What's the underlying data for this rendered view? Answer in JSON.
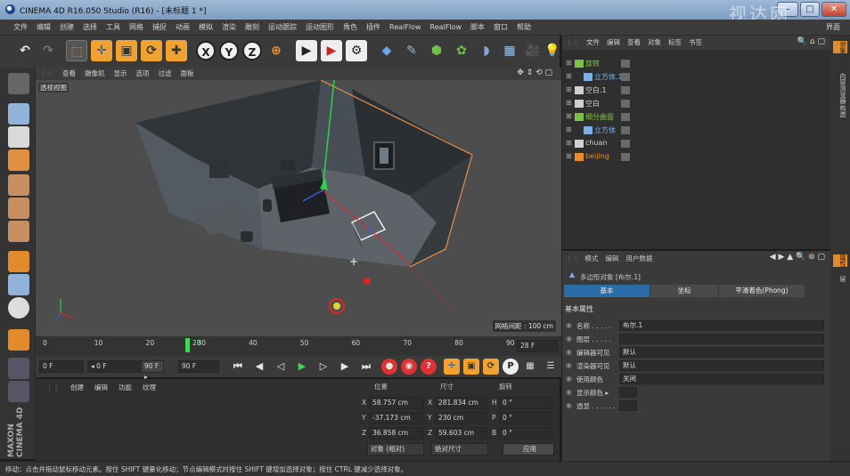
{
  "window": {
    "title": "CINEMA 4D R16.050 Studio (R16) - [未标题 1 *]",
    "watermark": "视达网"
  },
  "menu": [
    "文件",
    "编辑",
    "创建",
    "选择",
    "工具",
    "网格",
    "捕捉",
    "动画",
    "模拟",
    "渲染",
    "雕刻",
    "运动跟踪",
    "运动图形",
    "角色",
    "插件",
    "RealFlow",
    "RealFlow",
    "脚本",
    "窗口",
    "帮助"
  ],
  "menu_right": "界面",
  "toolbar": {
    "x": "X",
    "y": "Y",
    "z": "Z"
  },
  "viewport": {
    "menu": [
      "查看",
      "摄像机",
      "显示",
      "选项",
      "过滤",
      "面板"
    ],
    "label": "透视视图",
    "grid_info": "网格间距 : 100 cm"
  },
  "timeline": {
    "ticks": [
      "0",
      "10",
      "20",
      "30",
      "40",
      "50",
      "60",
      "70",
      "80",
      "90"
    ],
    "current_frame": "28",
    "end_field": "28 F",
    "field_start": "0 F",
    "field_min": "◂ 0 F",
    "field_max": "90 F ▸",
    "field_end": "90 F"
  },
  "material_panel": {
    "tabs": [
      "创建",
      "编辑",
      "功能",
      "纹理"
    ]
  },
  "coords": {
    "headers": [
      "位置",
      "尺寸",
      "旋转"
    ],
    "rows": [
      {
        "axis": "X",
        "pos": "58.757 cm",
        "size_axis": "X",
        "size": "281.834 cm",
        "rot_axis": "H",
        "rot": "0 °"
      },
      {
        "axis": "Y",
        "pos": "-37.173 cm",
        "size_axis": "Y",
        "size": "230 cm",
        "rot_axis": "P",
        "rot": "0 °"
      },
      {
        "axis": "Z",
        "pos": "36.858 cm",
        "size_axis": "Z",
        "size": "59.603 cm",
        "rot_axis": "B",
        "rot": "0 °"
      }
    ],
    "mode_object": "对象 (相对)",
    "mode_size": "绝对尺寸",
    "apply": "应用"
  },
  "objects_panel": {
    "menu": [
      "文件",
      "编辑",
      "查看",
      "对象",
      "标签",
      "书签"
    ],
    "items": [
      {
        "name": "旋转",
        "color": "#7ec242",
        "level": 0
      },
      {
        "name": "立方体.1",
        "color": "#7ab0e6",
        "level": 1
      },
      {
        "name": "空白.1",
        "color": "#d0d0d0",
        "level": 0
      },
      {
        "name": "空白",
        "color": "#d0d0d0",
        "level": 0
      },
      {
        "name": "细分曲面",
        "color": "#7ec242",
        "level": 0
      },
      {
        "name": "立方体",
        "color": "#7ab0e6",
        "level": 1
      },
      {
        "name": "chuan",
        "color": "#d0d0d0",
        "level": 0
      },
      {
        "name": "beijing",
        "color": "#e8902a",
        "level": 0
      }
    ]
  },
  "attributes_panel": {
    "menu": [
      "模式",
      "编辑",
      "用户数据"
    ],
    "object_title": "多边形对象 [布尔.1]",
    "tabs": [
      "基本",
      "坐标",
      "平滑着色(Phong)"
    ],
    "section": "基本属性",
    "fields": [
      {
        "label": "名称 . . . . .",
        "value": "布尔.1"
      },
      {
        "label": "图层 . . . . .",
        "value": ""
      },
      {
        "label": "编辑器可见",
        "value": "默认"
      },
      {
        "label": "渲染器可见",
        "value": "默认"
      },
      {
        "label": "使用颜色",
        "value": "关闭"
      },
      {
        "label": "显示颜色 ▸",
        "value": ""
      },
      {
        "label": "透显 . . . . . .",
        "value": ""
      }
    ]
  },
  "right_tabs": [
    "对象",
    "内容浏览器",
    "构造"
  ],
  "right_tabs_lower": [
    "属性",
    "层"
  ],
  "status": "移动：点击并拖动鼠标移动元素。按住 SHIFT 键量化移动；节点编辑模式时按住 SHIFT 键增加选择对象；按住 CTRL 键减少选择对象。",
  "logo": "MAXON CINEMA 4D"
}
